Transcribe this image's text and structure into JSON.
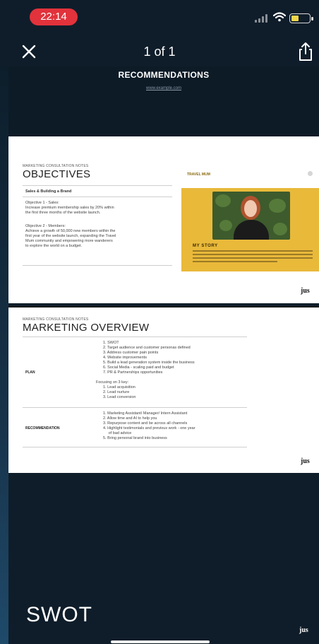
{
  "status_bar": {
    "time": "22:14"
  },
  "nav": {
    "page_indicator": "1 of 1",
    "close_icon": "close-icon",
    "share_icon": "share-icon"
  },
  "top_slide": {
    "title": "RECOMMENDATIONS",
    "link": "www.example.com"
  },
  "slide_objectives": {
    "kicker": "MARKETING CONSULTATION NOTES",
    "heading": "OBJECTIVES",
    "section": "Sales & Building a Brand",
    "objective1_title": "Objective 1 - Sales:",
    "objective1_lines": [
      "Increase premium membership sales by 20% within",
      "the first three months of the website launch."
    ],
    "objective2_title": "Objective 2 - Members:",
    "objective2_lines": [
      "Achieve a growth of 50,000 new members within the",
      "first year of the website launch, expanding the Travel",
      "Mum community and empowering more wanderers",
      "to explore the world on a budget."
    ],
    "panel_tag": "TRAVEL MUM",
    "panel_heading": "MY STORY",
    "brand": "jus"
  },
  "slide_marketing": {
    "kicker": "MARKETING CONSULTATION NOTES",
    "heading": "MARKETING OVERVIEW",
    "plan_label": "PLAN",
    "plan_items": [
      "1.  SWOT",
      "2.  Target audience and customer personas defined",
      "3.  Address customer pain points",
      "4.  Website improvements",
      "5.  Build a lead generation system inside the business",
      "6.  Social Media - scaling paid and budget",
      "7.  PR & Partnerships opportunities"
    ],
    "focus_title": "Focusing on 3 key:",
    "focus_items": [
      "1.  Lead acquisition",
      "2.  Lead nurture",
      "3.  Lead conversion"
    ],
    "recommendation_label": "RECOMMENDATION",
    "recommendation_items": [
      "1.  Marketing Assistant/ Manager/ Intern Assistant",
      "2.  Allow time and AI to help you",
      "3.  Repurpose content and be across all channels",
      "4.  Highlight testimonials and previous work - one year",
      "     of bad advice",
      "5.  Bring personal brand into business"
    ],
    "brand": "jus"
  },
  "bottom_slide": {
    "title": "SWOT",
    "brand": "jus"
  },
  "colors": {
    "background": "#0f1d2a",
    "time_pill": "#e2323b",
    "panel_yellow": "#e9b93a"
  }
}
